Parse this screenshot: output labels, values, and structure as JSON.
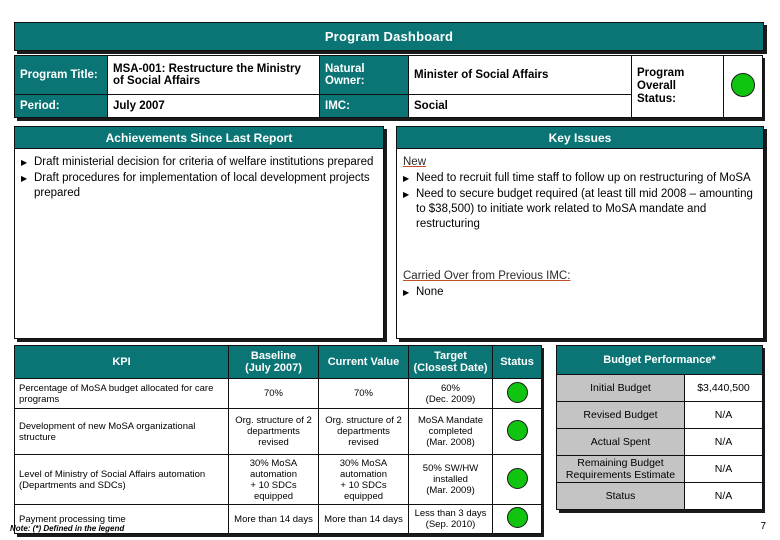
{
  "title": "Program Dashboard",
  "info": {
    "program_title_label": "Program Title:",
    "program_title_value": "MSA-001: Restructure the Ministry of Social Affairs",
    "period_label": "Period:",
    "period_value": "July 2007",
    "natural_owner_label": "Natural Owner:",
    "natural_owner_value": "Minister of Social Affairs",
    "imc_label": "IMC:",
    "imc_value": "Social",
    "overall_status_label": "Program Overall Status:",
    "overall_status_color": "#10c410"
  },
  "achievements": {
    "header": "Achievements Since Last Report",
    "items": [
      "Draft ministerial decision for criteria of welfare institutions prepared",
      "Draft procedures for implementation of local development projects prepared"
    ]
  },
  "key_issues": {
    "header": "Key Issues",
    "new_label": "New",
    "new_items": [
      "Need to recruit full time staff to follow up on restructuring of MoSA",
      "Need to secure budget required (at least till mid 2008 – amounting to $38,500) to initiate work related to MoSA mandate and restructuring"
    ],
    "carried_over_label": "Carried Over from Previous IMC:",
    "carried_over_items": [
      "None"
    ]
  },
  "kpi_table": {
    "columns": [
      "KPI",
      "Baseline (July 2007)",
      "Current Value",
      "Target (Closest Date)",
      "Status"
    ],
    "columns_multiline": [
      [
        "KPI"
      ],
      [
        "Baseline",
        "(July 2007)"
      ],
      [
        "Current Value"
      ],
      [
        "Target",
        "(Closest Date)"
      ],
      [
        "Status"
      ]
    ],
    "rows": [
      {
        "kpi": "Percentage of MoSA budget allocated for care programs",
        "baseline": [
          "70%"
        ],
        "current": [
          "70%"
        ],
        "target": [
          "60%",
          "(Dec. 2009)"
        ],
        "status_color": "#10c410"
      },
      {
        "kpi": "Development of new MoSA organizational structure",
        "baseline": [
          "Org. structure of 2",
          "departments",
          "revised"
        ],
        "current": [
          "Org. structure of 2",
          "departments",
          "revised"
        ],
        "target": [
          "MoSA Mandate",
          "completed",
          "(Mar. 2008)"
        ],
        "status_color": "#10c410"
      },
      {
        "kpi": "Level of Ministry of Social Affairs automation (Departments and SDCs)",
        "baseline": [
          "30% MoSA",
          "automation",
          "+ 10 SDCs",
          "equipped"
        ],
        "current": [
          "30% MoSA",
          "automation",
          "+ 10 SDCs",
          "equipped"
        ],
        "target": [
          "50% SW/HW",
          "installed",
          "(Mar. 2009)"
        ],
        "status_color": "#10c410"
      },
      {
        "kpi": "Payment processing time",
        "baseline": [
          "More than 14 days"
        ],
        "current": [
          "More than 14 days"
        ],
        "target": [
          "Less than 3 days",
          "(Sep. 2010)"
        ],
        "status_color": "#10c410"
      }
    ]
  },
  "budget_table": {
    "header": "Budget Performance*",
    "rows": [
      {
        "label": "Initial Budget",
        "value": "$3,440,500"
      },
      {
        "label": "Revised Budget",
        "value": "N/A"
      },
      {
        "label": "Actual Spent",
        "value": "N/A"
      },
      {
        "label": "Remaining Budget Requirements Estimate",
        "value": "N/A"
      },
      {
        "label": "Status",
        "value": "N/A"
      }
    ]
  },
  "footer": {
    "note": "Note: (*) Defined in the legend",
    "page_number": "7"
  },
  "colors": {
    "teal": "#0b7575",
    "green_light": "#10c410",
    "gray_label": "#c4c4c4",
    "underline_accent": "#c0522a"
  }
}
